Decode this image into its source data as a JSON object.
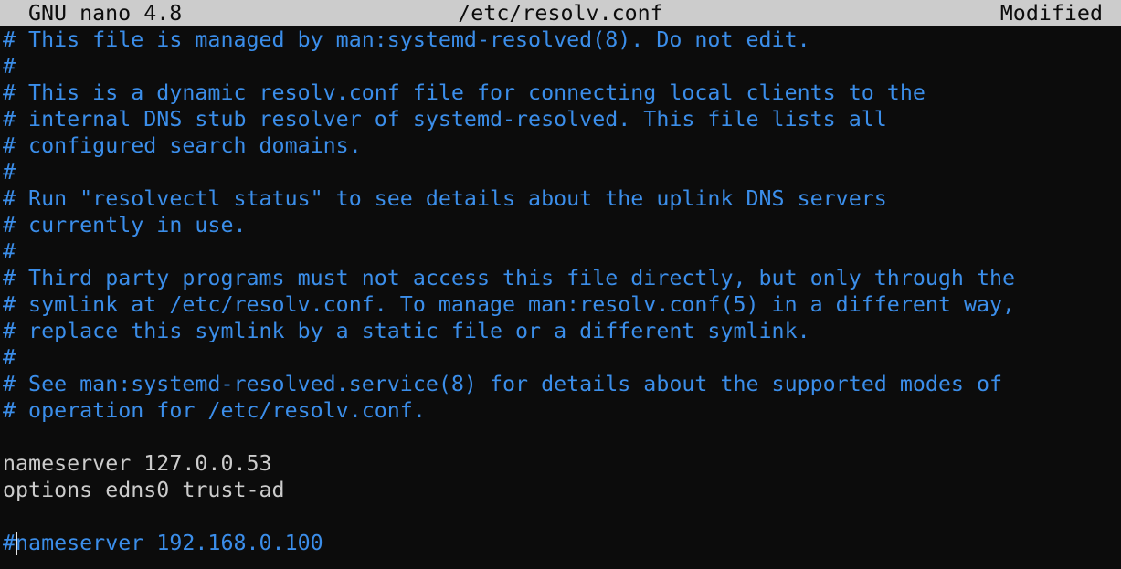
{
  "titlebar": {
    "app_name": "GNU nano 4.8",
    "file_path": "/etc/resolv.conf",
    "status": "Modified"
  },
  "editor": {
    "lines": [
      "# This file is managed by man:systemd-resolved(8). Do not edit.",
      "#",
      "# This is a dynamic resolv.conf file for connecting local clients to the",
      "# internal DNS stub resolver of systemd-resolved. This file lists all",
      "# configured search domains.",
      "#",
      "# Run \"resolvectl status\" to see details about the uplink DNS servers",
      "# currently in use.",
      "#",
      "# Third party programs must not access this file directly, but only through the",
      "# symlink at /etc/resolv.conf. To manage man:resolv.conf(5) in a different way,",
      "# replace this symlink by a static file or a different symlink.",
      "#",
      "# See man:systemd-resolved.service(8) for details about the supported modes of",
      "# operation for /etc/resolv.conf.",
      "",
      "nameserver 127.0.0.53",
      "options edns0 trust-ad",
      ""
    ],
    "cursor_line": {
      "prefix": "#",
      "rest": "nameserver 192.168.0.100"
    }
  },
  "colors": {
    "background": "#0c0c0c",
    "titlebar_bg": "#cccccc",
    "titlebar_fg": "#0c0c0c",
    "comment": "#3b8eea",
    "text": "#cccccc"
  }
}
